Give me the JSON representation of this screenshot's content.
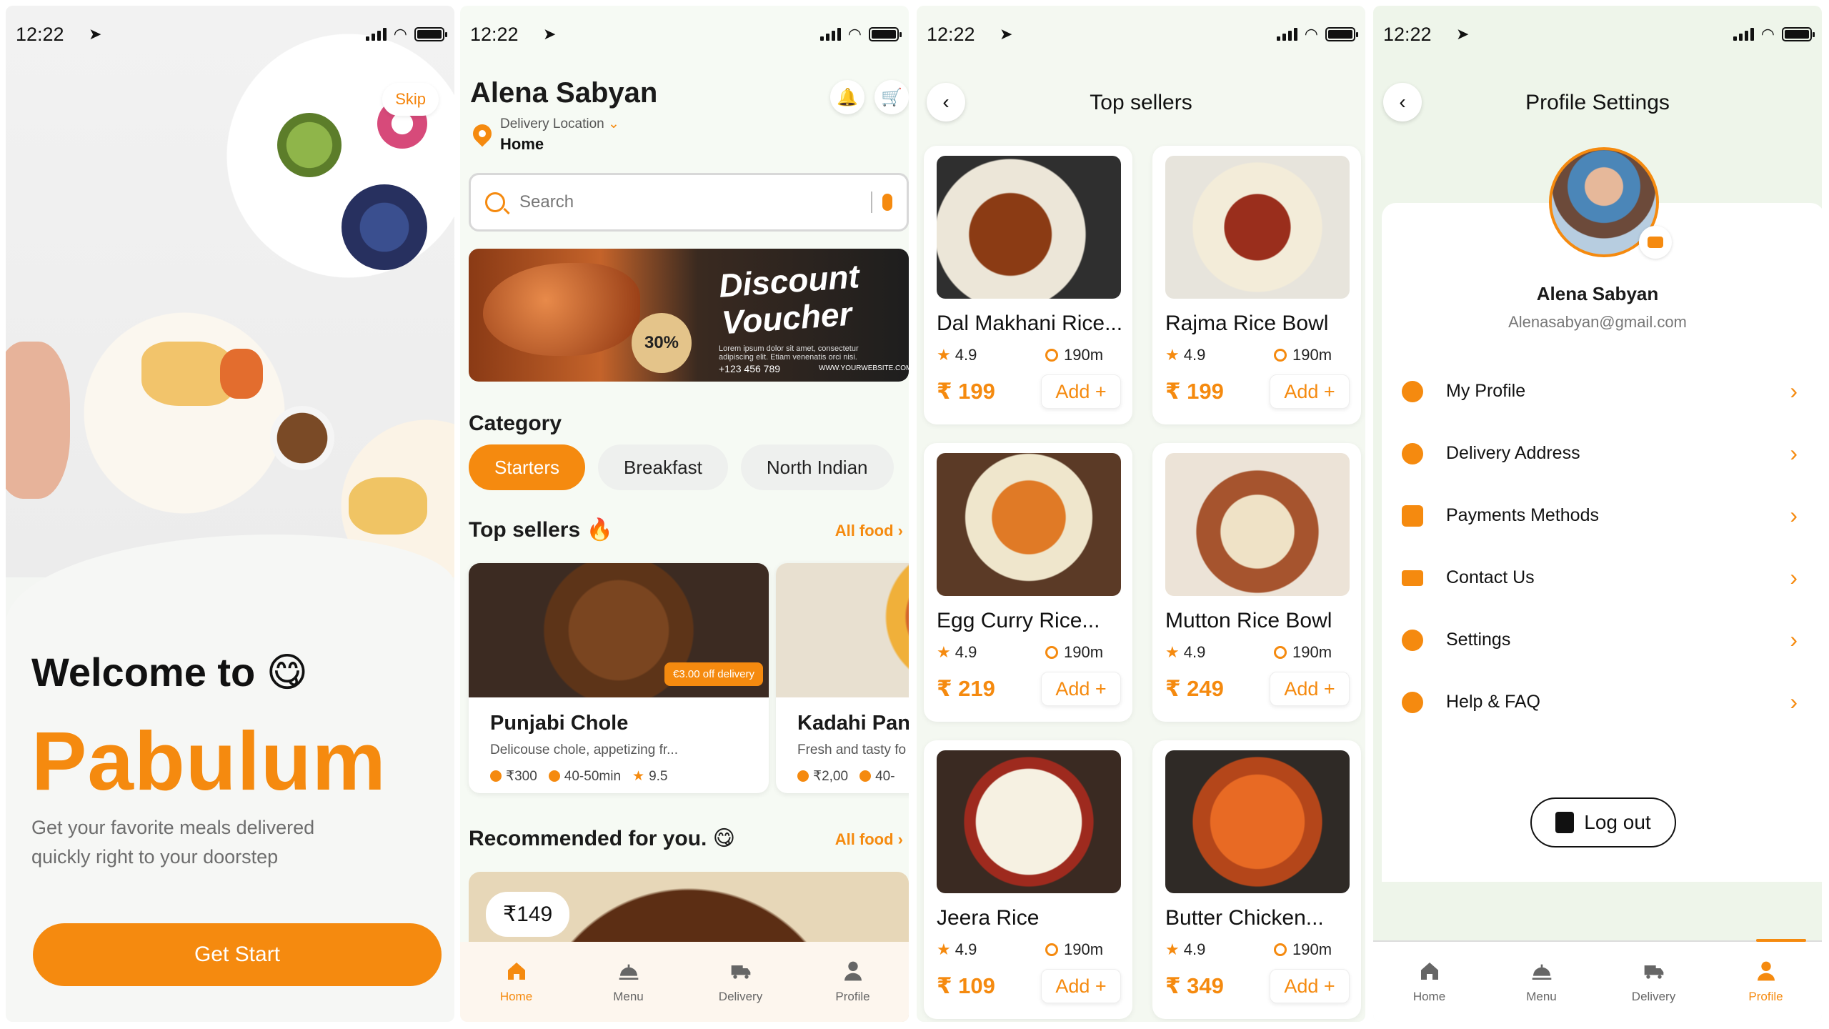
{
  "status_bar": {
    "time": "12:22"
  },
  "onboarding": {
    "skip_label": "Skip",
    "welcome_text": "Welcome to 😋",
    "brand_name": "Pabulum",
    "tagline": "Get your favorite meals delivered quickly right to your doorstep",
    "get_start_label": "Get Start"
  },
  "home": {
    "user_name": "Alena Sabyan",
    "delivery_location_label": "Delivery Location",
    "delivery_location_value": "Home",
    "search_placeholder": "Search",
    "banner": {
      "title_1": "Discount",
      "title_2": "Voucher",
      "discount_badge": "30%",
      "fine_print": "Lorem ipsum dolor sit amet, consectetur adipiscing elit. Etiam venenatis orci nisi.",
      "phone": "+123 456 789",
      "website": "WWW.YOURWEBSITE.COM"
    },
    "category_title": "Category",
    "categories": [
      "Starters",
      "Breakfast",
      "North Indian"
    ],
    "top_sellers_title": "Top sellers 🔥",
    "all_food_label": "All food ›",
    "top_seller_cards": [
      {
        "name": "Punjabi Chole",
        "description": "Delicouse chole, appetizing fr...",
        "price": "₹300",
        "time": "40-50min",
        "rating": "9.5",
        "promo": "€3.00 off delivery"
      },
      {
        "name": "Kadahi Paneer",
        "description": "Fresh and tasty fo",
        "price": "₹2,00",
        "time": "40-",
        "rating": ""
      }
    ],
    "recommended_title": "Recommended  for you. 😋",
    "recommended_price": "₹149"
  },
  "tabbar": {
    "home": "Home",
    "menu": "Menu",
    "delivery": "Delivery",
    "profile": "Profile"
  },
  "top_sellers_page": {
    "title": "Top sellers",
    "items": [
      {
        "name": "Dal Makhani Rice...",
        "rating": "4.9",
        "distance": "190m",
        "price": "₹ 199",
        "add": "Add +"
      },
      {
        "name": "Rajma Rice Bowl",
        "rating": "4.9",
        "distance": "190m",
        "price": "₹ 199",
        "add": "Add +"
      },
      {
        "name": "Egg Curry Rice...",
        "rating": "4.9",
        "distance": "190m",
        "price": "₹ 219",
        "add": "Add +"
      },
      {
        "name": "Mutton Rice Bowl",
        "rating": "4.9",
        "distance": "190m",
        "price": "₹ 249",
        "add": "Add +"
      },
      {
        "name": "Jeera Rice",
        "rating": "4.9",
        "distance": "190m",
        "price": "₹ 109",
        "add": "Add +"
      },
      {
        "name": "Butter Chicken...",
        "rating": "4.9",
        "distance": "190m",
        "price": "₹ 349",
        "add": "Add +"
      }
    ]
  },
  "profile_settings": {
    "title": "Profile Settings",
    "name": "Alena Sabyan",
    "email": "Alenasabyan@gmail.com",
    "menu_items": [
      "My Profile",
      "Delivery Address",
      "Payments Methods",
      "Contact Us",
      "Settings",
      "Help & FAQ"
    ],
    "logout_label": "Log out"
  },
  "colors": {
    "accent": "#f58a0f",
    "text": "#111111",
    "muted": "#777777"
  }
}
